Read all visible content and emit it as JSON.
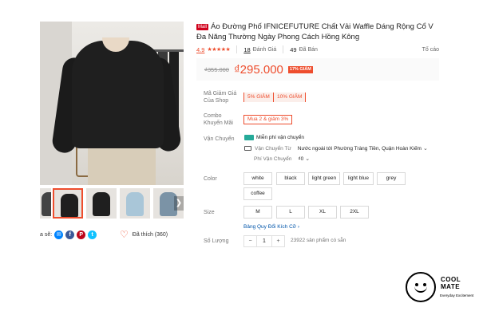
{
  "product": {
    "mall_badge": "Mall",
    "title": "Áo Đường Phố IFNICEFUTURE Chất Vải Waffle Dáng Rộng Cổ V Đa Năng Thường Ngày Phong Cách Hồng Kông",
    "rating": "4.9",
    "stars": "★★★★★",
    "reviews_count": "18",
    "reviews_label": "Đánh Giá",
    "sold_count": "49",
    "sold_label": "Đã Bán",
    "report_label": "Tố cáo",
    "old_price": "₫355.000",
    "price": "₫295.000",
    "discount": "17% GIẢM"
  },
  "gallery": {
    "next_arrow": "❯"
  },
  "share": {
    "label": "a sẽ:",
    "icons": [
      "messenger-icon",
      "facebook-icon",
      "pinterest-icon",
      "twitter-icon"
    ],
    "glyphs": [
      "✉",
      "f",
      "P",
      "t"
    ]
  },
  "like": {
    "heart": "♡",
    "label": "Đã thích (360)"
  },
  "shop_vouchers": {
    "label": "Mã Giảm Giá Của Shop",
    "items": [
      "5% GIẢM",
      "10% GIẢM"
    ]
  },
  "combo": {
    "label": "Combo Khuyến Mãi",
    "value": "Mua 2 & giảm 3%"
  },
  "shipping": {
    "label": "Vận Chuyển",
    "free": "Miễn phí vận chuyển",
    "from_label": "Vận Chuyển Từ",
    "from_value": "Nước ngoài tới Phường Tràng Tiền, Quận Hoàn Kiếm",
    "fee_label": "Phí Vận Chuyển",
    "fee_value": "₫0"
  },
  "color": {
    "label": "Color",
    "options": [
      "white",
      "black",
      "light green",
      "light blue",
      "grey",
      "coffee"
    ]
  },
  "size": {
    "label": "Size",
    "options": [
      "M",
      "L",
      "XL",
      "2XL"
    ],
    "guide_link": "Bảng Quy Đổi Kích Cỡ ›"
  },
  "quantity": {
    "label": "Số Lượng",
    "minus": "−",
    "value": "1",
    "plus": "+",
    "stock": "23922 sản phẩm có sẵn"
  },
  "brand": {
    "name_line1": "COOL",
    "name_line2": "MATE",
    "tagline": "Everyday Excitement"
  },
  "colors": {
    "accent": "#ee4d2d",
    "shipping_green": "#26aa99",
    "link_blue": "#0055aa"
  }
}
